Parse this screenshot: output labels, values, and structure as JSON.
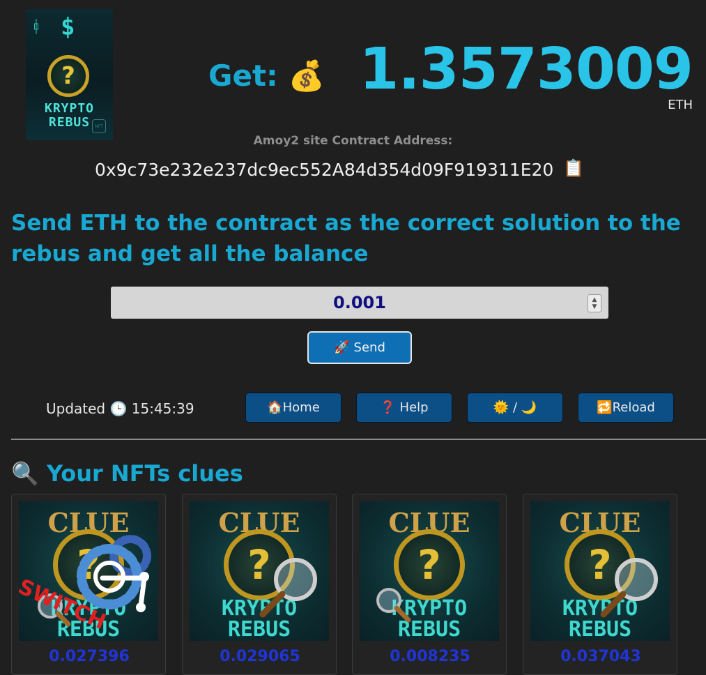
{
  "header": {
    "logo_word1": "KRYPTO",
    "logo_word2": "REBUS",
    "logo_badge": "NFT",
    "get_label": "Get:",
    "get_icon": "💰",
    "balance": "1.3573009",
    "unit": "ETH"
  },
  "contract": {
    "label": "Amoy2 site Contract Address:",
    "address": "0x9c73e232e237dc9ec552A84d354d09F919311E20",
    "copy_icon": "📋"
  },
  "instruction": "Send ETH to the contract as the correct solution to the rebus and get all the balance",
  "form": {
    "amount_value": "0.001",
    "send_icon": "🚀",
    "send_label": "Send"
  },
  "status": {
    "updated_label": "Updated",
    "clock_icon": "🕒",
    "time": "15:45:39"
  },
  "nav": {
    "home": "🏠Home",
    "help": "❓ Help",
    "theme": "🌞 / 🌙",
    "reload": "🔁Reload"
  },
  "nfts": {
    "title_icon": "🔍",
    "title": "Your NFTs clues",
    "cards": [
      {
        "clue": "CLUE",
        "q": "?",
        "word1": "KRYPTO",
        "word2": "REBUS",
        "overlay_text": "SWITCH",
        "value": "0.027396"
      },
      {
        "clue": "CLUE",
        "q": "?",
        "word1": "KRYPTO",
        "word2": "REBUS",
        "value": "0.029065"
      },
      {
        "clue": "CLUE",
        "q": "?",
        "word1": "KRYPTO",
        "word2": "REBUS",
        "value": "0.008235"
      },
      {
        "clue": "CLUE",
        "q": "?",
        "word1": "KRYPTO",
        "word2": "REBUS",
        "value": "0.037043"
      }
    ]
  },
  "colors": {
    "background": "#1f1f1f",
    "accent": "#19a8d2",
    "balance": "#29c4e8",
    "button": "#0c4f86",
    "card_value": "#1f35d6"
  }
}
